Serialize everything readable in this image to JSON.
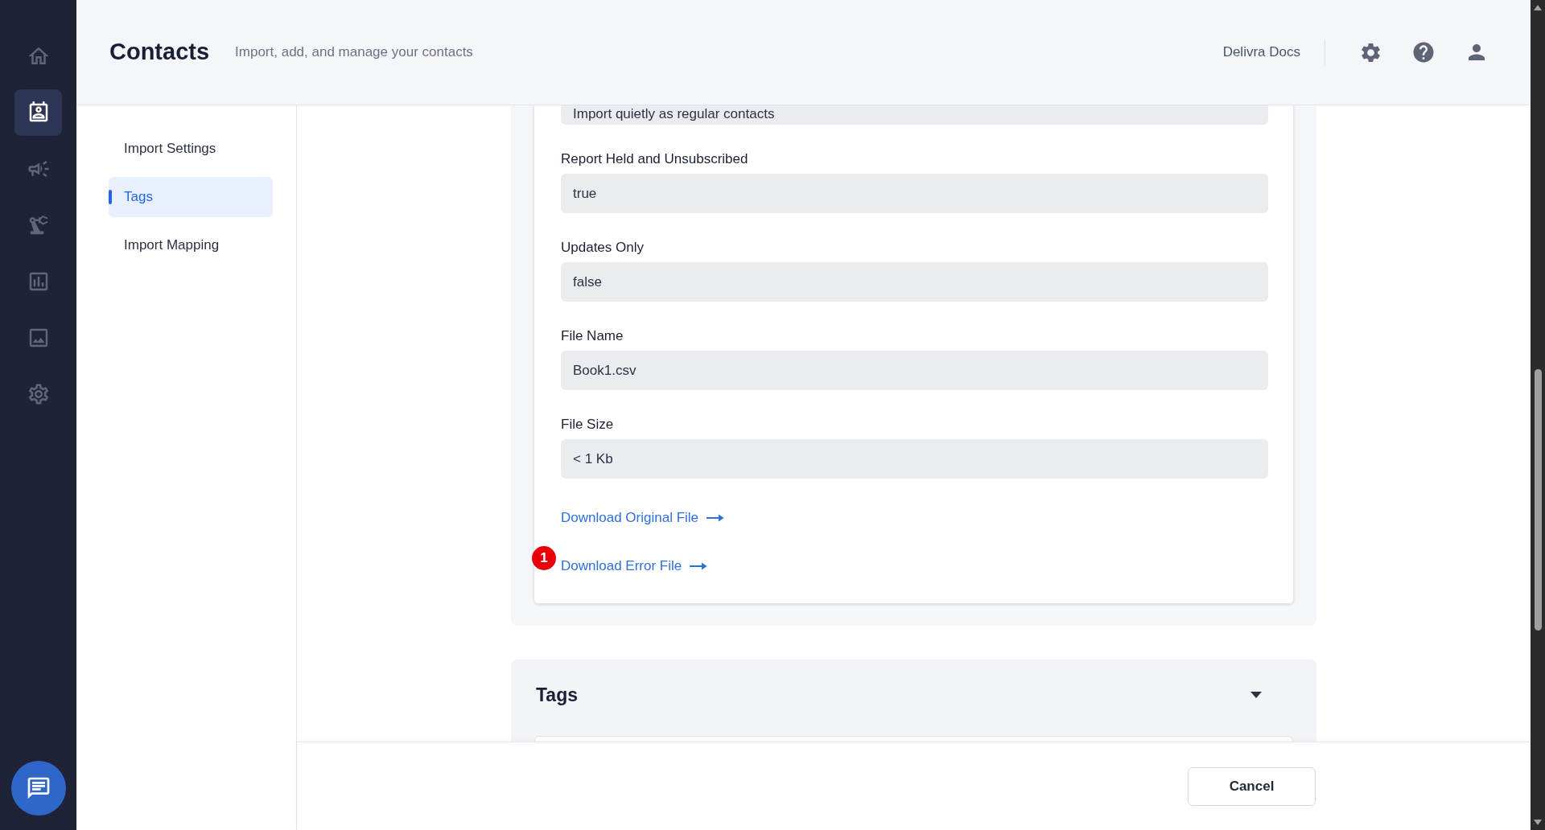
{
  "nav_rail": {
    "items": [
      {
        "selected": false
      },
      {
        "selected": true
      },
      {
        "selected": false
      },
      {
        "selected": false
      },
      {
        "selected": false
      },
      {
        "selected": false
      },
      {
        "selected": false
      }
    ]
  },
  "header": {
    "title": "Contacts",
    "subtitle": "Import, add, and manage your contacts",
    "docs_link": "Delivra Docs"
  },
  "section_nav": {
    "items": [
      {
        "label": "Import Settings",
        "selected": false
      },
      {
        "label": "Tags",
        "selected": true
      },
      {
        "label": "Import Mapping",
        "selected": false
      }
    ]
  },
  "import_settings": {
    "fields": [
      {
        "value": "Import quietly as regular contacts"
      },
      {
        "label": "Report Held and Unsubscribed",
        "value": "true"
      },
      {
        "label": "Updates Only",
        "value": "false"
      },
      {
        "label": "File Name",
        "value": "Book1.csv"
      },
      {
        "label": "File Size",
        "value": "< 1 Kb"
      }
    ],
    "links": [
      {
        "label": "Download Original File"
      },
      {
        "label": "Download Error File",
        "badge": "1"
      }
    ]
  },
  "tags_section": {
    "title": "Tags"
  },
  "footer": {
    "buttons": [
      "Cancel"
    ]
  }
}
